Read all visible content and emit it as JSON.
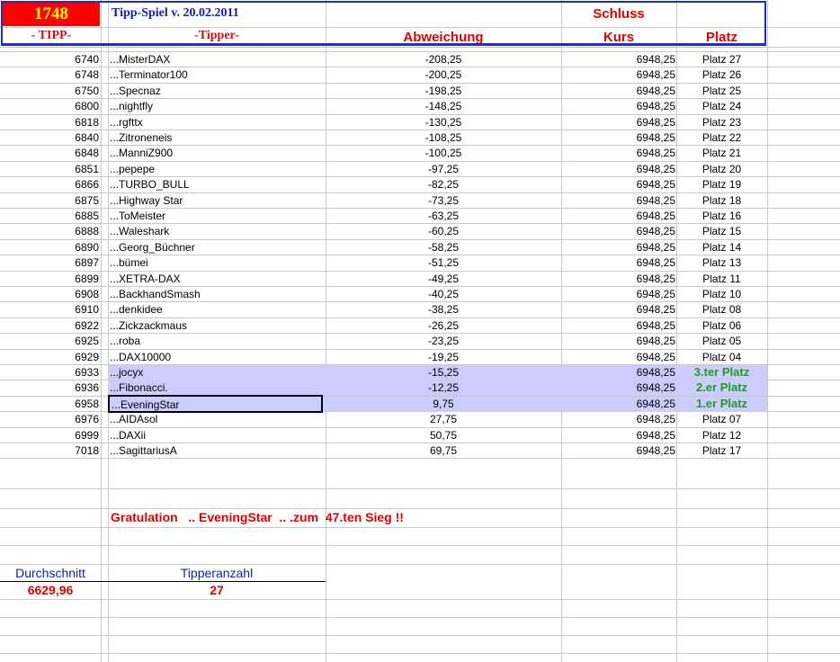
{
  "header": {
    "round": "1748",
    "title": "Tipp-Spiel v. 20.02.2011",
    "tipp_label": "- TIPP-",
    "tipper_label": "-Tipper-",
    "abweichung_label": "Abweichung",
    "schluss_label": "Schluss",
    "kurs_label": "Kurs",
    "platz_label": "Platz"
  },
  "rows": [
    {
      "tipp": "6740",
      "name": "...MisterDAX",
      "abw": "-208,25",
      "kurs": "6948,25",
      "platz": "Platz 27"
    },
    {
      "tipp": "6748",
      "name": "...Terminator100",
      "abw": "-200,25",
      "kurs": "6948,25",
      "platz": "Platz 26"
    },
    {
      "tipp": "6750",
      "name": "...Specnaz",
      "abw": "-198,25",
      "kurs": "6948,25",
      "platz": "Platz 25"
    },
    {
      "tipp": "6800",
      "name": "...nightfly",
      "abw": "-148,25",
      "kurs": "6948,25",
      "platz": "Platz 24"
    },
    {
      "tipp": "6818",
      "name": "...rgfttx",
      "abw": "-130,25",
      "kurs": "6948,25",
      "platz": "Platz 23"
    },
    {
      "tipp": "6840",
      "name": "...Zitroneneis",
      "abw": "-108,25",
      "kurs": "6948,25",
      "platz": "Platz 22"
    },
    {
      "tipp": "6848",
      "name": "...ManniZ900",
      "abw": "-100,25",
      "kurs": "6948,25",
      "platz": "Platz 21"
    },
    {
      "tipp": "6851",
      "name": "...pepepe",
      "abw": "-97,25",
      "kurs": "6948,25",
      "platz": "Platz 20"
    },
    {
      "tipp": "6866",
      "name": "...TURBO_BULL",
      "abw": "-82,25",
      "kurs": "6948,25",
      "platz": "Platz 19"
    },
    {
      "tipp": "6875",
      "name": "...Highway Star",
      "abw": "-73,25",
      "kurs": "6948,25",
      "platz": "Platz 18"
    },
    {
      "tipp": "6885",
      "name": "...ToMeister",
      "abw": "-63,25",
      "kurs": "6948,25",
      "platz": "Platz 16"
    },
    {
      "tipp": "6888",
      "name": "...Waleshark",
      "abw": "-60,25",
      "kurs": "6948,25",
      "platz": "Platz 15"
    },
    {
      "tipp": "6890",
      "name": "...Georg_Büchner",
      "abw": "-58,25",
      "kurs": "6948,25",
      "platz": "Platz 14"
    },
    {
      "tipp": "6897",
      "name": "...bümei",
      "abw": "-51,25",
      "kurs": "6948,25",
      "platz": "Platz 13"
    },
    {
      "tipp": "6899",
      "name": "...XETRA-DAX",
      "abw": "-49,25",
      "kurs": "6948,25",
      "platz": "Platz 11"
    },
    {
      "tipp": "6908",
      "name": "...BackhandSmash",
      "abw": "-40,25",
      "kurs": "6948,25",
      "platz": "Platz 10"
    },
    {
      "tipp": "6910",
      "name": "...denkidee",
      "abw": "-38,25",
      "kurs": "6948,25",
      "platz": "Platz 08"
    },
    {
      "tipp": "6922",
      "name": "...Zickzackmaus",
      "abw": "-26,25",
      "kurs": "6948,25",
      "platz": "Platz 06"
    },
    {
      "tipp": "6925",
      "name": "...roba",
      "abw": "-23,25",
      "kurs": "6948,25",
      "platz": "Platz 05"
    },
    {
      "tipp": "6929",
      "name": "...DAX10000",
      "abw": "-19,25",
      "kurs": "6948,25",
      "platz": "Platz 04"
    },
    {
      "tipp": "6933",
      "name": "...jocyx",
      "abw": "-15,25",
      "kurs": "6948,25",
      "platz": "3.ter Platz",
      "top": true
    },
    {
      "tipp": "6936",
      "name": "...Fibonacci.",
      "abw": "-12,25",
      "kurs": "6948,25",
      "platz": "2.er Platz",
      "top": true
    },
    {
      "tipp": "6958",
      "name": "...EveningStar",
      "abw": "9,75",
      "kurs": "6948,25",
      "platz": "1.er Platz",
      "top": true,
      "selected": true
    },
    {
      "tipp": "6976",
      "name": "...AIDAsol",
      "abw": "27,75",
      "kurs": "6948,25",
      "platz": "Platz 07"
    },
    {
      "tipp": "6999",
      "name": "...DAXii",
      "abw": "50,75",
      "kurs": "6948,25",
      "platz": "Platz 12"
    },
    {
      "tipp": "7018",
      "name": "...SagittariusA",
      "abw": "69,75",
      "kurs": "6948,25",
      "platz": "Platz 17"
    }
  ],
  "footer": {
    "gratulation": "Gratulation   .. EveningStar  .. .zum  47.ten Sieg !!",
    "durchschnitt_label": "Durchschnitt",
    "durchschnitt_value": "6629,96",
    "tipperanzahl_label": "Tipperanzahl",
    "tipperanzahl_value": "27"
  }
}
